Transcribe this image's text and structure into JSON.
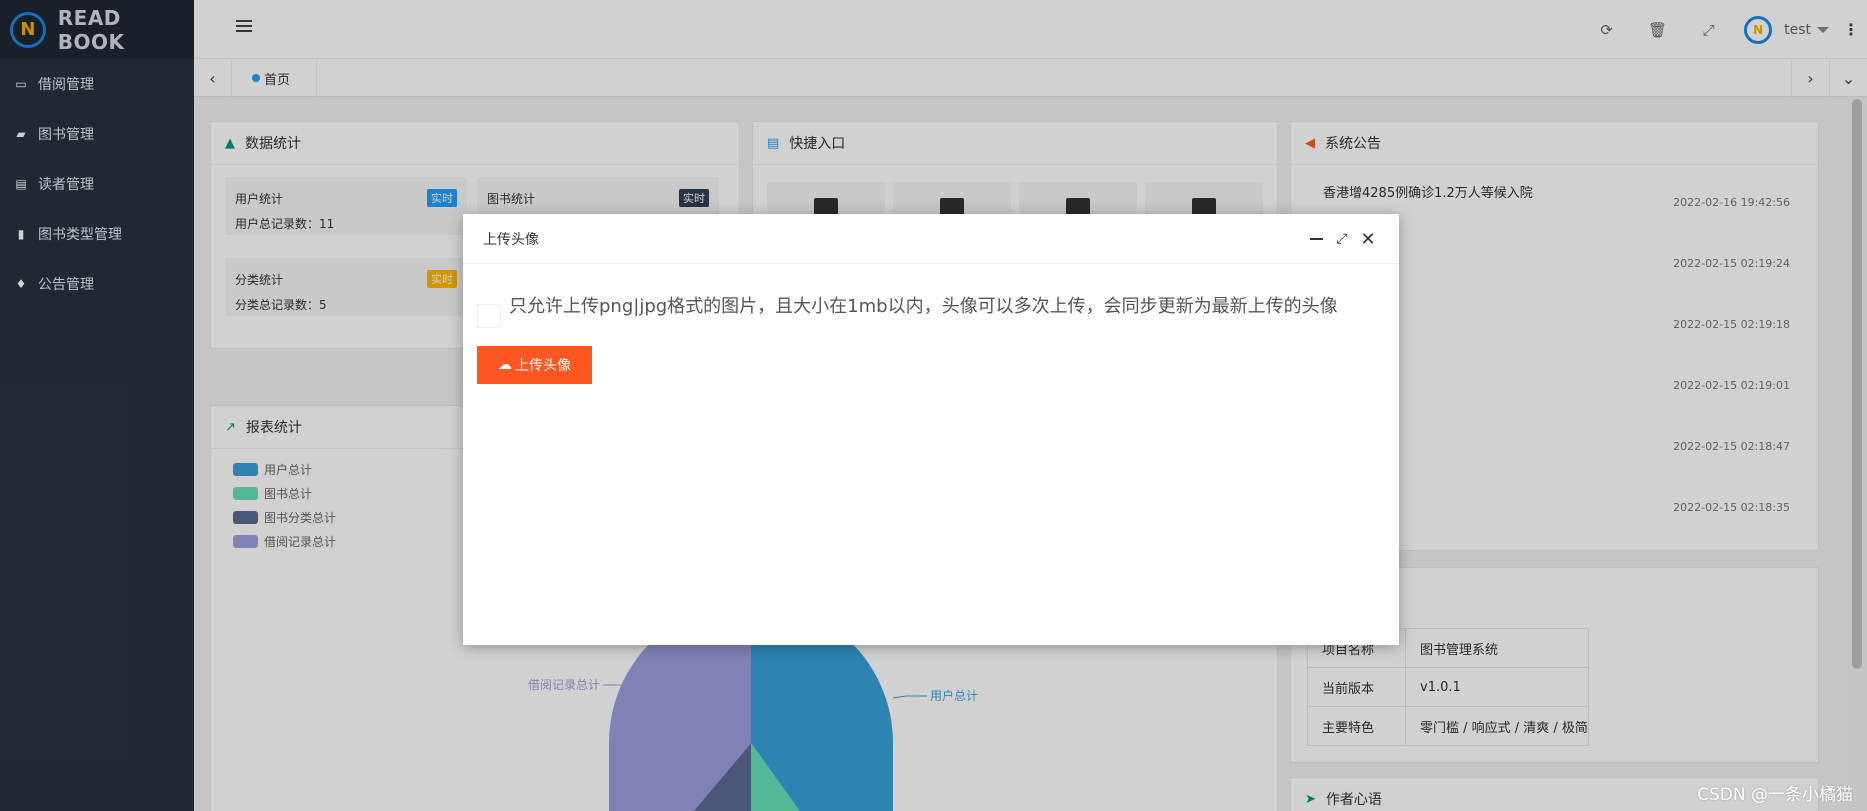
{
  "brand": {
    "title": "READ BOOK",
    "logo_text": "N"
  },
  "sidebar": {
    "items": [
      {
        "label": "借阅管理",
        "icon": "window-icon"
      },
      {
        "label": "图书管理",
        "icon": "book-icon"
      },
      {
        "label": "读者管理",
        "icon": "card-icon"
      },
      {
        "label": "图书类型管理",
        "icon": "file-icon"
      },
      {
        "label": "公告管理",
        "icon": "bell-icon"
      }
    ]
  },
  "header": {
    "username": "test",
    "icons": [
      "refresh-icon",
      "trash-icon",
      "fullscreen-icon",
      "more-icon"
    ]
  },
  "tabs": {
    "home_label": "首页"
  },
  "stats_card": {
    "title": "数据统计",
    "boxes": [
      {
        "label": "用户统计",
        "badge": "实时",
        "count_label": "用户总记录数：",
        "count": "11",
        "badge_color": "#1e9fff"
      },
      {
        "label": "图书统计",
        "badge": "实时",
        "count_label": "",
        "count": "",
        "badge_color": "#2f4056"
      },
      {
        "label": "分类统计",
        "badge": "实时",
        "count_label": "分类总记录数：",
        "count": "5",
        "badge_color": "#ffb800"
      }
    ]
  },
  "quick_card": {
    "title": "快捷入口"
  },
  "notice_card": {
    "title": "系统公告",
    "items": [
      {
        "title": "香港增4285例确诊1.2万人等候入院",
        "date": "2022-02-16 19:42:56"
      },
      {
        "title": "",
        "date": "2022-02-15 02:19:24"
      },
      {
        "title": "",
        "date": "2022-02-15 02:19:18"
      },
      {
        "title": "",
        "date": "2022-02-15 02:19:01"
      },
      {
        "title": "",
        "date": "2022-02-15 02:18:47"
      },
      {
        "title": "",
        "date": "2022-02-15 02:18:35"
      }
    ]
  },
  "report_card": {
    "title": "报表统计"
  },
  "chart_data": {
    "type": "pie",
    "title": "",
    "legend": [
      "用户总计",
      "图书总计",
      "图书分类总计",
      "借阅记录总计"
    ],
    "colors": [
      "#37a2da",
      "#67e0b8",
      "#5b6b93",
      "#9d9fe0"
    ],
    "visible_slice_labels": [
      "用户总计",
      "借阅记录总计"
    ]
  },
  "version_card": {
    "rows": [
      {
        "key": "项目名称",
        "value": "图书管理系统"
      },
      {
        "key": "当前版本",
        "value": "v1.0.1"
      },
      {
        "key": "主要特色",
        "value": "零门槛 / 响应式 / 清爽 / 极简"
      }
    ]
  },
  "author_card": {
    "title": "作者心语"
  },
  "modal": {
    "title": "上传头像",
    "hint": "只允许上传png|jpg格式的图片，且大小在1mb以内，头像可以多次上传，会同步更新为最新上传的头像",
    "button_label": "上传头像"
  },
  "watermark": "CSDN @一条小橘猫"
}
